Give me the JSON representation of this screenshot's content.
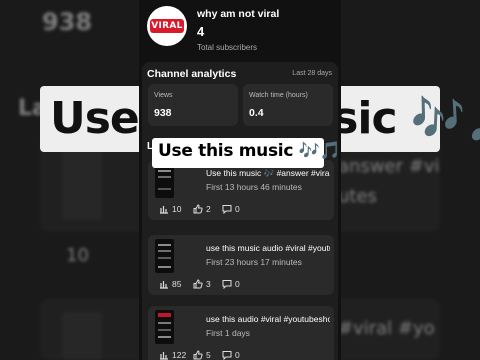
{
  "channel": {
    "name": "why am not viral",
    "logo_text": "VIRAL",
    "subscribers": "4",
    "subscribers_label": "Total subscribers"
  },
  "analytics": {
    "title": "Channel analytics",
    "period": "Last 28 days",
    "views_label": "Views",
    "views_value": "938",
    "watch_label": "Watch time (hours)",
    "watch_value": "0.4"
  },
  "section_label": "L",
  "overlay": {
    "caption": "Use this music 🎶🎵"
  },
  "videos": [
    {
      "title": "Use this music 🎶 #answer #viral",
      "time": "First 13 hours 46 minutes",
      "views": "10",
      "likes": "2",
      "comments": "0"
    },
    {
      "title": "use this music audio #viral #youtube",
      "time": "First 23 hours 17 minutes",
      "views": "85",
      "likes": "3",
      "comments": "0"
    },
    {
      "title": "use this audio #viral #youtubeshorts",
      "time": "First 1 days",
      "views": "122",
      "likes": "5",
      "comments": "0"
    }
  ],
  "background": {
    "top_number": "938",
    "caption": "Use this music 🎶🎵",
    "section_label": "La",
    "row_text_1": "answer #vi",
    "row_text_2": "utes",
    "row_metric": "10",
    "row_text_3": "#viral #yo"
  },
  "colors": {
    "logo_red": "#d91a2a",
    "card_bg": "#2a2a2a",
    "panel_bg": "#1e1e1e"
  }
}
